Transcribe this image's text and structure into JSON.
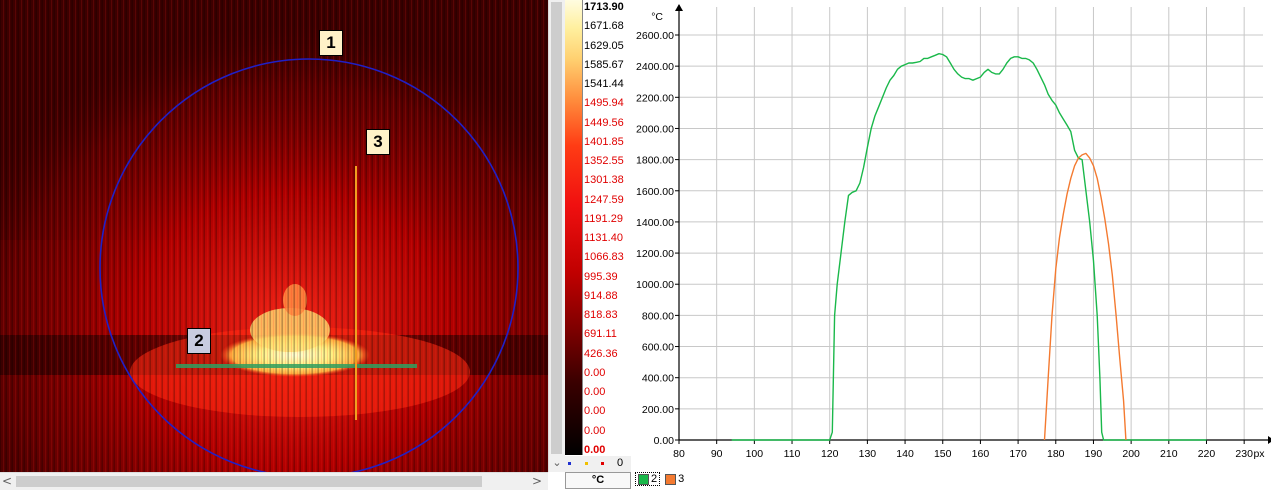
{
  "thermal_view": {
    "markers": [
      {
        "label": "1",
        "bg": "#fff2c8"
      },
      {
        "label": "2",
        "bg": "#c8cce0"
      },
      {
        "label": "3",
        "bg": "#fff2c8"
      }
    ]
  },
  "scrollbars": {
    "left_arrow": "<",
    "right_arrow": ">",
    "down_arrow": "⌄"
  },
  "palette": {
    "labels": [
      {
        "text": "1713.90",
        "color": "#000000",
        "bold": true
      },
      {
        "text": "1671.68",
        "color": "#000000",
        "bold": false
      },
      {
        "text": "1629.05",
        "color": "#000000",
        "bold": false
      },
      {
        "text": "1585.67",
        "color": "#000000",
        "bold": false
      },
      {
        "text": "1541.44",
        "color": "#000000",
        "bold": false
      },
      {
        "text": "1495.94",
        "color": "#e00000",
        "bold": false
      },
      {
        "text": "1449.56",
        "color": "#e00000",
        "bold": false
      },
      {
        "text": "1401.85",
        "color": "#e00000",
        "bold": false
      },
      {
        "text": "1352.55",
        "color": "#e00000",
        "bold": false
      },
      {
        "text": "1301.38",
        "color": "#e00000",
        "bold": false
      },
      {
        "text": "1247.59",
        "color": "#e00000",
        "bold": false
      },
      {
        "text": "1191.29",
        "color": "#e00000",
        "bold": false
      },
      {
        "text": "1131.40",
        "color": "#e00000",
        "bold": false
      },
      {
        "text": "1066.83",
        "color": "#e00000",
        "bold": false
      },
      {
        "text": "995.39",
        "color": "#e00000",
        "bold": false
      },
      {
        "text": "914.88",
        "color": "#e00000",
        "bold": false
      },
      {
        "text": "818.83",
        "color": "#e00000",
        "bold": false
      },
      {
        "text": "691.11",
        "color": "#e00000",
        "bold": false
      },
      {
        "text": "426.36",
        "color": "#e00000",
        "bold": false
      },
      {
        "text": "0.00",
        "color": "#e00000",
        "bold": false
      },
      {
        "text": "0.00",
        "color": "#e00000",
        "bold": false
      },
      {
        "text": "0.00",
        "color": "#e00000",
        "bold": false
      },
      {
        "text": "0.00",
        "color": "#e00000",
        "bold": false
      },
      {
        "text": "0.00",
        "color": "#e00000",
        "bold": true
      }
    ],
    "footer_value": "0",
    "footer_dot_colors": [
      "#2030d0",
      "#f0c000",
      "#e00000"
    ],
    "unit": "°C"
  },
  "chart_data": {
    "type": "line",
    "ylabel": "°C",
    "xlabel": "px",
    "xlim": [
      80,
      235
    ],
    "ylim": [
      0,
      2600
    ],
    "x_ticks": [
      80,
      90,
      100,
      110,
      120,
      130,
      140,
      150,
      160,
      170,
      180,
      190,
      200,
      210,
      220,
      230
    ],
    "y_ticks": [
      "0.00",
      "200.00",
      "400.00",
      "600.00",
      "800.00",
      "1000.00",
      "1200.00",
      "1400.00",
      "1600.00",
      "1800.00",
      "2000.00",
      "2200.00",
      "2400.00",
      "2600.00"
    ],
    "grid": true,
    "series": [
      {
        "name": "2",
        "color": "#1ab84a",
        "points": [
          [
            94,
            0
          ],
          [
            120,
            0
          ],
          [
            120.7,
            50
          ],
          [
            121.3,
            800
          ],
          [
            122,
            1000
          ],
          [
            123,
            1200
          ],
          [
            124,
            1400
          ],
          [
            125,
            1570
          ],
          [
            126,
            1590
          ],
          [
            127,
            1600
          ],
          [
            128,
            1650
          ],
          [
            129,
            1750
          ],
          [
            130,
            1880
          ],
          [
            131,
            2000
          ],
          [
            132,
            2080
          ],
          [
            133,
            2140
          ],
          [
            134,
            2200
          ],
          [
            135,
            2260
          ],
          [
            136,
            2310
          ],
          [
            137,
            2340
          ],
          [
            138,
            2380
          ],
          [
            139,
            2400
          ],
          [
            140,
            2410
          ],
          [
            141,
            2420
          ],
          [
            142,
            2420
          ],
          [
            143,
            2425
          ],
          [
            144,
            2430
          ],
          [
            145,
            2450
          ],
          [
            146,
            2450
          ],
          [
            147,
            2460
          ],
          [
            148,
            2470
          ],
          [
            149,
            2480
          ],
          [
            150,
            2475
          ],
          [
            151,
            2460
          ],
          [
            152,
            2420
          ],
          [
            153,
            2380
          ],
          [
            154,
            2350
          ],
          [
            155,
            2330
          ],
          [
            156,
            2320
          ],
          [
            157,
            2320
          ],
          [
            158,
            2310
          ],
          [
            159,
            2320
          ],
          [
            160,
            2330
          ],
          [
            161,
            2360
          ],
          [
            162,
            2380
          ],
          [
            163,
            2360
          ],
          [
            164,
            2350
          ],
          [
            165,
            2350
          ],
          [
            166,
            2380
          ],
          [
            167,
            2420
          ],
          [
            168,
            2450
          ],
          [
            169,
            2460
          ],
          [
            170,
            2460
          ],
          [
            171,
            2450
          ],
          [
            172,
            2450
          ],
          [
            173,
            2440
          ],
          [
            174,
            2420
          ],
          [
            175,
            2380
          ],
          [
            176,
            2330
          ],
          [
            177,
            2280
          ],
          [
            178,
            2220
          ],
          [
            179,
            2180
          ],
          [
            180,
            2150
          ],
          [
            181,
            2100
          ],
          [
            182,
            2060
          ],
          [
            183,
            2020
          ],
          [
            184,
            1980
          ],
          [
            185,
            1860
          ],
          [
            186,
            1810
          ],
          [
            187,
            1800
          ],
          [
            187.5,
            1700
          ],
          [
            188,
            1600
          ],
          [
            189,
            1400
          ],
          [
            190,
            1150
          ],
          [
            191,
            800
          ],
          [
            191.7,
            400
          ],
          [
            192.2,
            50
          ],
          [
            192.7,
            0
          ],
          [
            220,
            0
          ]
        ]
      },
      {
        "name": "3",
        "color": "#f47a30",
        "points": [
          [
            177,
            0
          ],
          [
            178,
            400
          ],
          [
            179,
            800
          ],
          [
            180,
            1100
          ],
          [
            181,
            1300
          ],
          [
            182,
            1450
          ],
          [
            183,
            1580
          ],
          [
            184,
            1680
          ],
          [
            185,
            1760
          ],
          [
            186,
            1810
          ],
          [
            187,
            1830
          ],
          [
            188,
            1840
          ],
          [
            189,
            1810
          ],
          [
            190,
            1760
          ],
          [
            191,
            1680
          ],
          [
            192,
            1560
          ],
          [
            193,
            1420
          ],
          [
            194,
            1260
          ],
          [
            195,
            1060
          ],
          [
            196,
            800
          ],
          [
            197,
            520
          ],
          [
            198,
            250
          ],
          [
            198.6,
            0
          ]
        ]
      }
    ],
    "legend": [
      {
        "label": "2",
        "color": "#1ab84a"
      },
      {
        "label": "3",
        "color": "#f47a30"
      }
    ],
    "legend_position": "bottom-left"
  }
}
